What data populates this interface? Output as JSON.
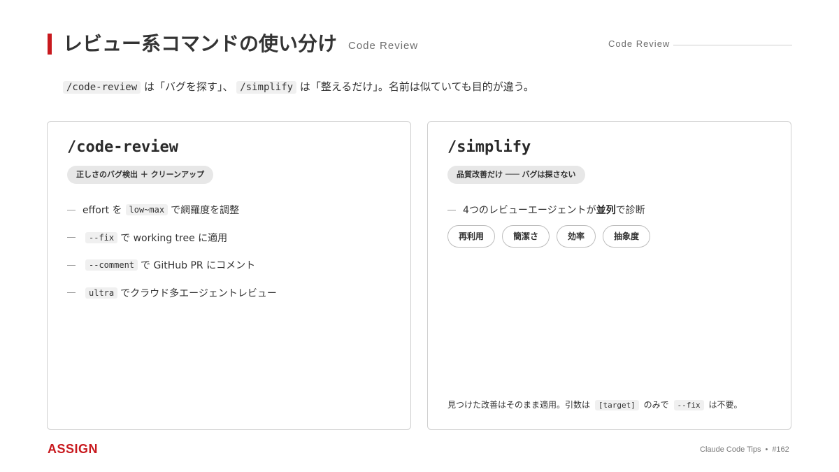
{
  "header": {
    "title": "レビュー系コマンドの使い分け",
    "title_sub": "Code Review",
    "top_right_label": "Code Review"
  },
  "subtitle": {
    "cmd1": "/code-review",
    "text1": "は「バグを探す」、",
    "cmd2": "/simplify",
    "text2": "は「整えるだけ」。名前は似ていても目的が違う。"
  },
  "left_card": {
    "title": "/code-review",
    "tag": "正しさのバグ検出 ＋ クリーンアップ",
    "items": [
      {
        "pre": "effort を",
        "code": "low~max",
        "post": "で網羅度を調整"
      },
      {
        "pre": "",
        "code": "--fix",
        "post": "で working tree に適用"
      },
      {
        "pre": "",
        "code": "--comment",
        "post": "で GitHub PR にコメント"
      },
      {
        "pre": "",
        "code": "ultra",
        "post": "でクラウド多エージェントレビュー"
      }
    ]
  },
  "right_card": {
    "title": "/simplify",
    "tag": "品質改善だけ ─── バグは探さない",
    "item": {
      "pre": "4つのレビューエージェントが",
      "bold": "並列",
      "post": "で診断"
    },
    "chips": [
      "再利用",
      "簡潔さ",
      "効率",
      "抽象度"
    ],
    "note": {
      "pre": "見つけた改善はそのまま適用。引数は",
      "code1": "[target]",
      "mid": "のみで",
      "code2": "--fix",
      "post": "は不要。"
    }
  },
  "footer": {
    "logo": "ASSIGN",
    "series": "Claude Code Tips",
    "separator": "•",
    "number": "#162"
  },
  "colors": {
    "accent": "#c8191e",
    "text": "#333333",
    "muted": "#6e6e6e",
    "border": "#cfcfcf",
    "tag_bg": "#e7e7e7",
    "code_bg": "#f0f0f0"
  }
}
